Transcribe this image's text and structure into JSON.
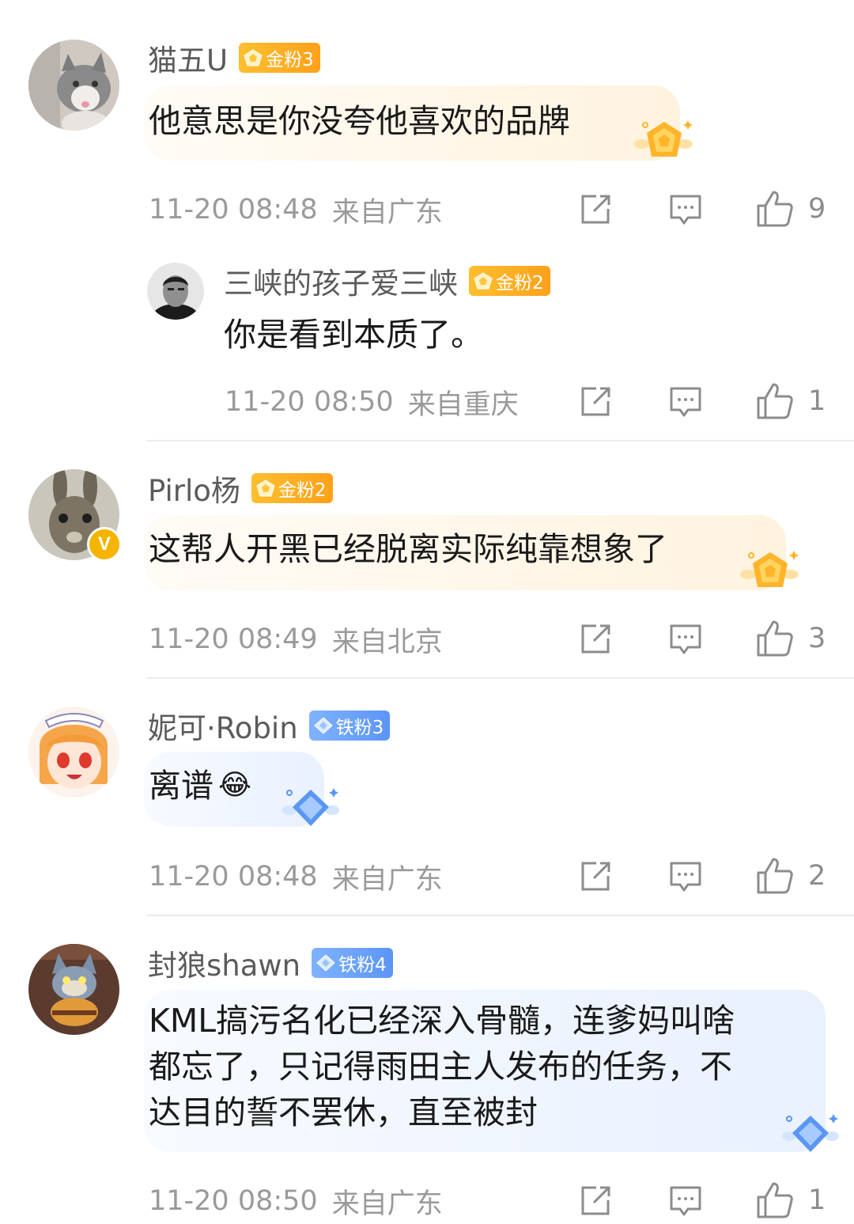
{
  "colors": {
    "gold_badge": "#ffb020",
    "iron_badge": "#6ea5fa",
    "meta_text": "#9a9a9a",
    "body_text": "#1a1a1a"
  },
  "comments": [
    {
      "username": "猫五U",
      "fan_badge": {
        "type": "gold",
        "label": "金粉3"
      },
      "text": "他意思是你没夸他喜欢的品牌",
      "time": "11-20 08:48",
      "location": "来自广东",
      "likes": "9",
      "avatar_icon": "cat-avatar"
    },
    {
      "username": "三峡的孩子爱三峡",
      "fan_badge": {
        "type": "gold",
        "label": "金粉2"
      },
      "text": "你是看到本质了。",
      "time": "11-20 08:50",
      "location": "来自重庆",
      "likes": "1",
      "avatar_icon": "person-avatar",
      "is_reply": true
    },
    {
      "username": "Pirlo杨",
      "fan_badge": {
        "type": "gold",
        "label": "金粉2"
      },
      "text": "这帮人开黑已经脱离实际纯靠想象了",
      "time": "11-20 08:49",
      "location": "来自北京",
      "likes": "3",
      "avatar_icon": "hare-avatar",
      "verified_icon": "verified-v-icon",
      "verified_label": "V"
    },
    {
      "username": "妮可·Robin",
      "fan_badge": {
        "type": "iron",
        "label": "铁粉3"
      },
      "text": "离谱",
      "emoji": "😂",
      "time": "11-20 08:48",
      "location": "来自广东",
      "likes": "2",
      "avatar_icon": "anime-girl-avatar"
    },
    {
      "username": "封狼shawn",
      "fan_badge": {
        "type": "iron",
        "label": "铁粉4"
      },
      "text": "KML搞污名化已经深入骨髓，连爹妈叫啥\n都忘了，只记得雨田主人发布的任务，不\n达目的誓不罢休，直至被封",
      "time": "11-20 08:50",
      "location": "来自广东",
      "likes": "1",
      "avatar_icon": "cartoon-cat-avatar"
    }
  ]
}
